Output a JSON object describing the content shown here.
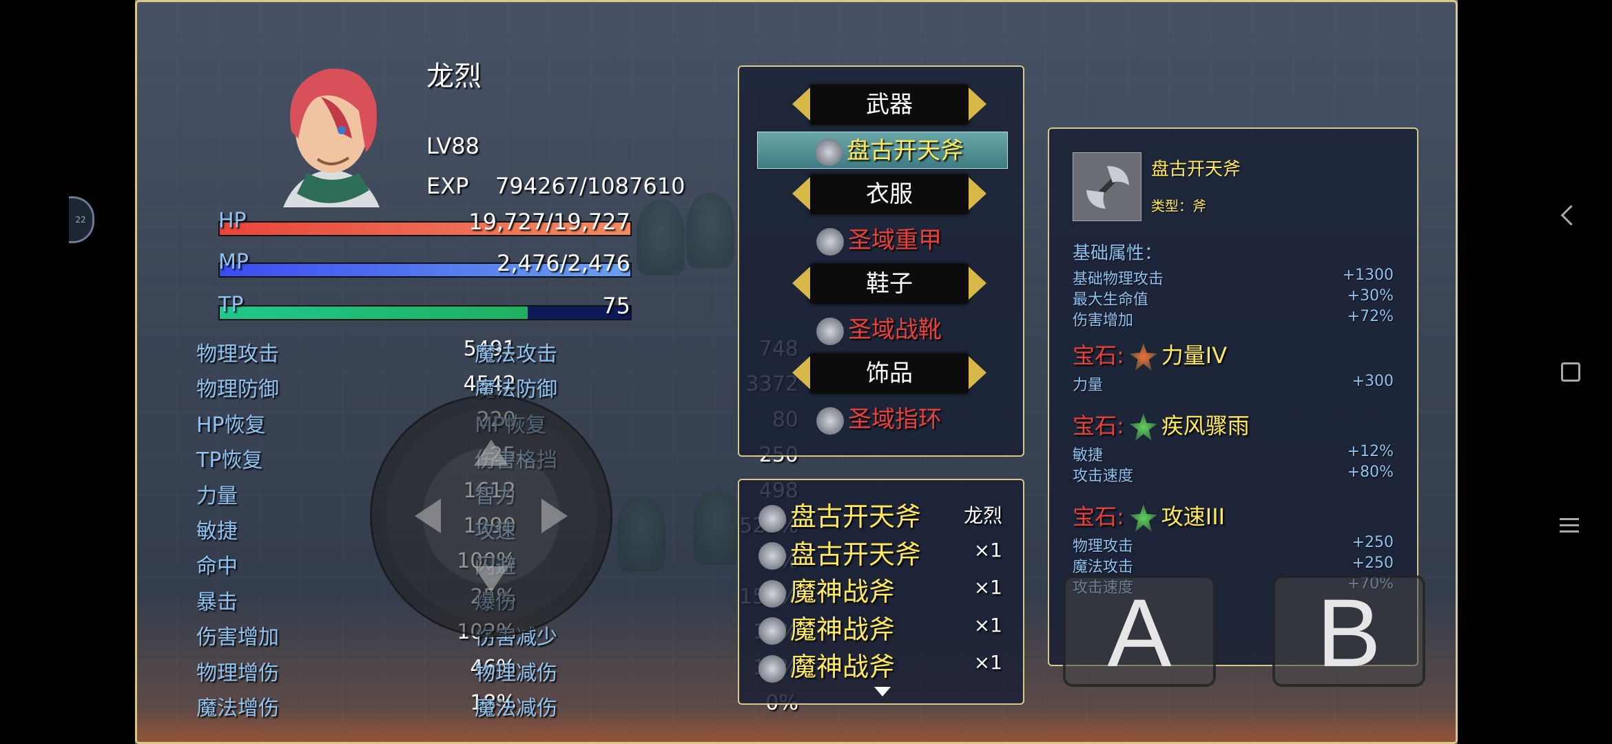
{
  "character": {
    "name": "龙烈",
    "level": "LV88",
    "exp_label": "EXP",
    "exp_value": "794267/1087610",
    "hp_label": "HP",
    "hp_value": "19,727/19,727",
    "hp_fraction": 1.0,
    "mp_label": "MP",
    "mp_value": "2,476/2,476",
    "mp_fraction": 1.0,
    "tp_label": "TP",
    "tp_value": "75",
    "tp_fraction": 0.75
  },
  "stats_left": [
    {
      "label": "物理攻击",
      "value": "5491"
    },
    {
      "label": "物理防御",
      "value": "4542"
    },
    {
      "label": "HP恢复",
      "value": "220"
    },
    {
      "label": "TP恢复",
      "value": "25"
    },
    {
      "label": "力量",
      "value": "1612"
    },
    {
      "label": "敏捷",
      "value": "1090"
    },
    {
      "label": "命中",
      "value": "100%"
    },
    {
      "label": "暴击",
      "value": "25%"
    },
    {
      "label": "伤害增加",
      "value": "102%"
    },
    {
      "label": "物理增伤",
      "value": "46%"
    },
    {
      "label": "魔法增伤",
      "value": "18%"
    }
  ],
  "stats_right": [
    {
      "label": "魔法攻击",
      "value": "748"
    },
    {
      "label": "魔法防御",
      "value": "3372"
    },
    {
      "label": "MP恢复",
      "value": "80"
    },
    {
      "label": "伤害格挡",
      "value": "250"
    },
    {
      "label": "智力",
      "value": "498"
    },
    {
      "label": "攻速",
      "value": "523%"
    },
    {
      "label": "闪避",
      "value": "0%"
    },
    {
      "label": "爆伤",
      "value": "150%"
    },
    {
      "label": "伤害减少",
      "value": "12%"
    },
    {
      "label": "物理减伤",
      "value": "14%"
    },
    {
      "label": "魔法减伤",
      "value": "0%"
    }
  ],
  "equipment": [
    {
      "slot": "武器",
      "item": "盘古开天斧",
      "selected": true,
      "icon": "axe-icon"
    },
    {
      "slot": "衣服",
      "item": "圣域重甲",
      "selected": false,
      "icon": "armor-icon"
    },
    {
      "slot": "鞋子",
      "item": "圣域战靴",
      "selected": false,
      "icon": "boots-icon"
    },
    {
      "slot": "饰品",
      "item": "圣域指环",
      "selected": false,
      "icon": "ring-icon"
    }
  ],
  "inventory": [
    {
      "name": "盘古开天斧",
      "qty": "龙烈"
    },
    {
      "name": "盘古开天斧",
      "qty": "×1"
    },
    {
      "name": "魔神战斧",
      "qty": "×1"
    },
    {
      "name": "魔神战斧",
      "qty": "×1"
    },
    {
      "name": "魔神战斧",
      "qty": "×1"
    }
  ],
  "detail": {
    "item_name": "盘古开天斧",
    "type_text": "类型：斧",
    "base_title": "基础属性：",
    "base_attrs": [
      {
        "label": "基础物理攻击",
        "value": "+1300"
      },
      {
        "label": "最大生命值",
        "value": "+30%"
      },
      {
        "label": "伤害增加",
        "value": "+72%"
      }
    ],
    "gem_label": "宝石:",
    "gems": [
      {
        "name": "力量IV",
        "attrs": [
          {
            "label": "力量",
            "value": "+300"
          }
        ]
      },
      {
        "name": "疾风骤雨",
        "attrs": [
          {
            "label": "敏捷",
            "value": "+12%"
          },
          {
            "label": "攻击速度",
            "value": "+80%"
          }
        ]
      },
      {
        "name": "攻速III",
        "attrs": [
          {
            "label": "物理攻击",
            "value": "+250"
          },
          {
            "label": "魔法攻击",
            "value": "+250"
          },
          {
            "label": "攻击速度",
            "value": "+70%"
          }
        ]
      }
    ]
  },
  "controls": {
    "a_label": "A",
    "b_label": "B"
  },
  "overlay_badge": "22",
  "colors": {
    "hp": "#e8453a",
    "mp": "#3a5cf0",
    "tp": "#1ec98a",
    "gold": "#d9c88a",
    "yellow": "#ffe95a",
    "red_item": "#e8403a",
    "label_blue": "#8ec2f0"
  }
}
